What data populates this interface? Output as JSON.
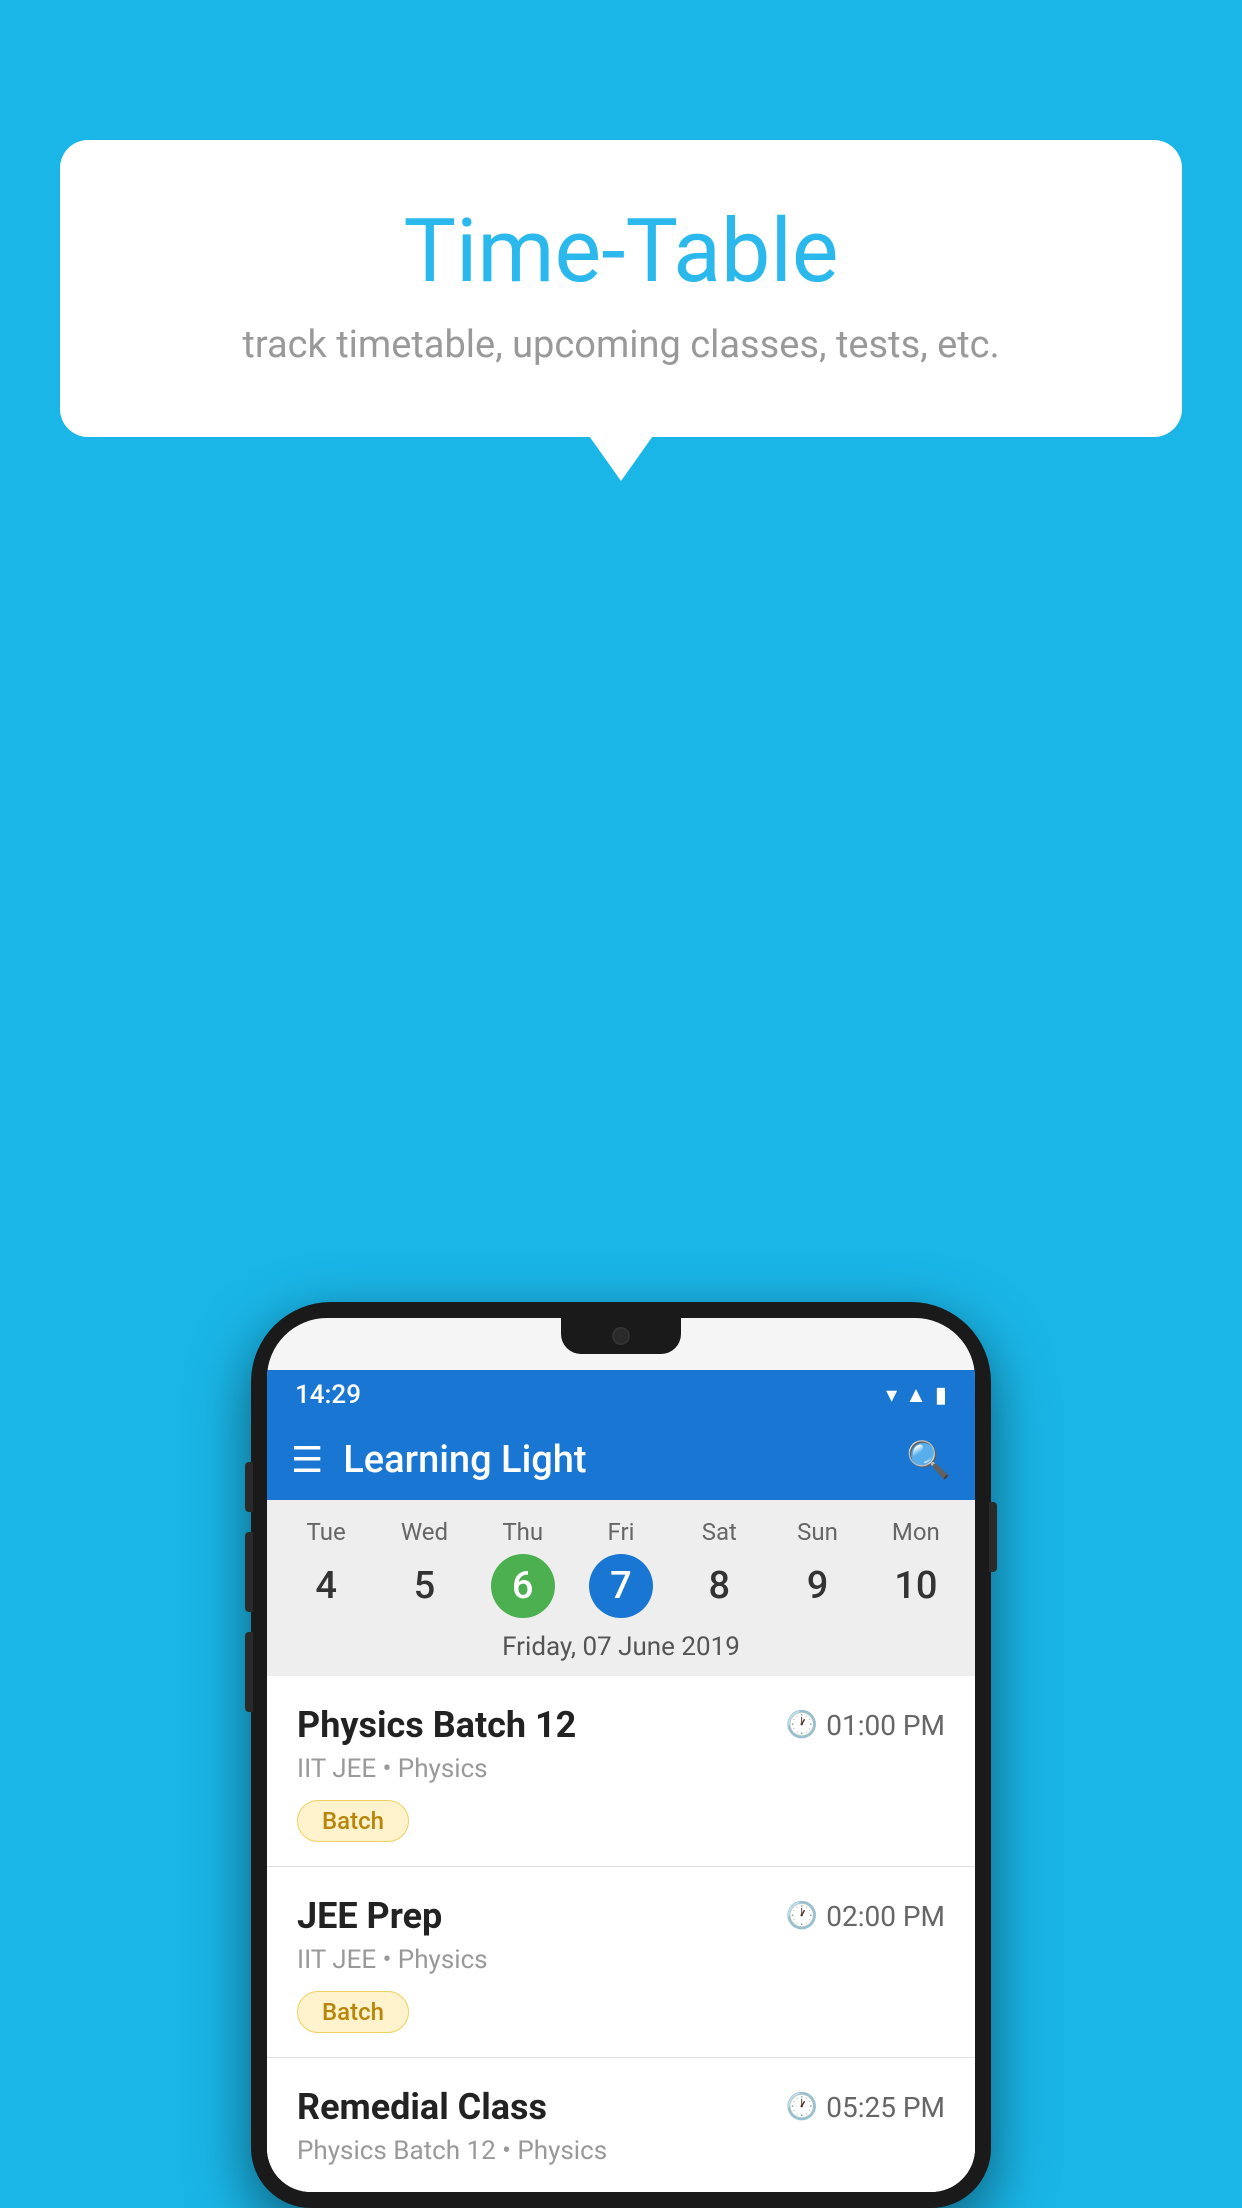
{
  "background_color": "#1ab6e8",
  "bubble": {
    "title": "Time-Table",
    "subtitle": "track timetable, upcoming classes, tests, etc."
  },
  "phone": {
    "status_bar": {
      "time": "14:29"
    },
    "app_bar": {
      "title": "Learning Light"
    },
    "calendar": {
      "days": [
        {
          "name": "Tue",
          "num": "4",
          "state": "normal"
        },
        {
          "name": "Wed",
          "num": "5",
          "state": "normal"
        },
        {
          "name": "Thu",
          "num": "6",
          "state": "today"
        },
        {
          "name": "Fri",
          "num": "7",
          "state": "selected"
        },
        {
          "name": "Sat",
          "num": "8",
          "state": "normal"
        },
        {
          "name": "Sun",
          "num": "9",
          "state": "normal"
        },
        {
          "name": "Mon",
          "num": "10",
          "state": "normal"
        }
      ],
      "selected_date_label": "Friday, 07 June 2019"
    },
    "schedule": [
      {
        "title": "Physics Batch 12",
        "time": "01:00 PM",
        "subtitle": "IIT JEE • Physics",
        "tag": "Batch"
      },
      {
        "title": "JEE Prep",
        "time": "02:00 PM",
        "subtitle": "IIT JEE • Physics",
        "tag": "Batch"
      },
      {
        "title": "Remedial Class",
        "time": "05:25 PM",
        "subtitle": "Physics Batch 12 • Physics",
        "tag": null
      }
    ]
  }
}
